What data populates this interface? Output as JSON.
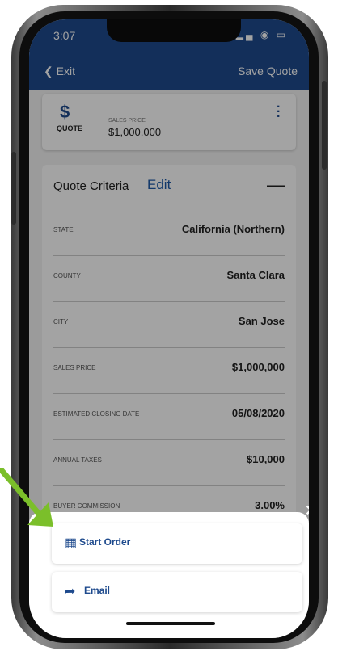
{
  "status_bar": {
    "time": "3:07",
    "icons": "▪︎ ᯤ ▭"
  },
  "nav": {
    "exit_label": "Exit",
    "save_label": "Save Quote"
  },
  "summary": {
    "quote_label": "QUOTE",
    "sales_price_label": "SALES PRICE",
    "sales_price_value": "$1,000,000"
  },
  "criteria": {
    "title": "Quote Criteria",
    "edit_label": "Edit",
    "rows": [
      {
        "label": "STATE",
        "value": "California (Northern)"
      },
      {
        "label": "COUNTY",
        "value": "Santa Clara"
      },
      {
        "label": "CITY",
        "value": "San Jose"
      },
      {
        "label": "SALES PRICE",
        "value": "$1,000,000"
      },
      {
        "label": "ESTIMATED CLOSING DATE",
        "value": "05/08/2020"
      },
      {
        "label": "ANNUAL TAXES",
        "value": "$10,000"
      },
      {
        "label": "BUYER COMMISSION",
        "value": "3.00%"
      }
    ]
  },
  "action_sheet": {
    "start_order_label": "Start Order",
    "email_label": "Email"
  },
  "colors": {
    "brand": "#1e4a8d",
    "arrow": "#7bbf2a"
  }
}
